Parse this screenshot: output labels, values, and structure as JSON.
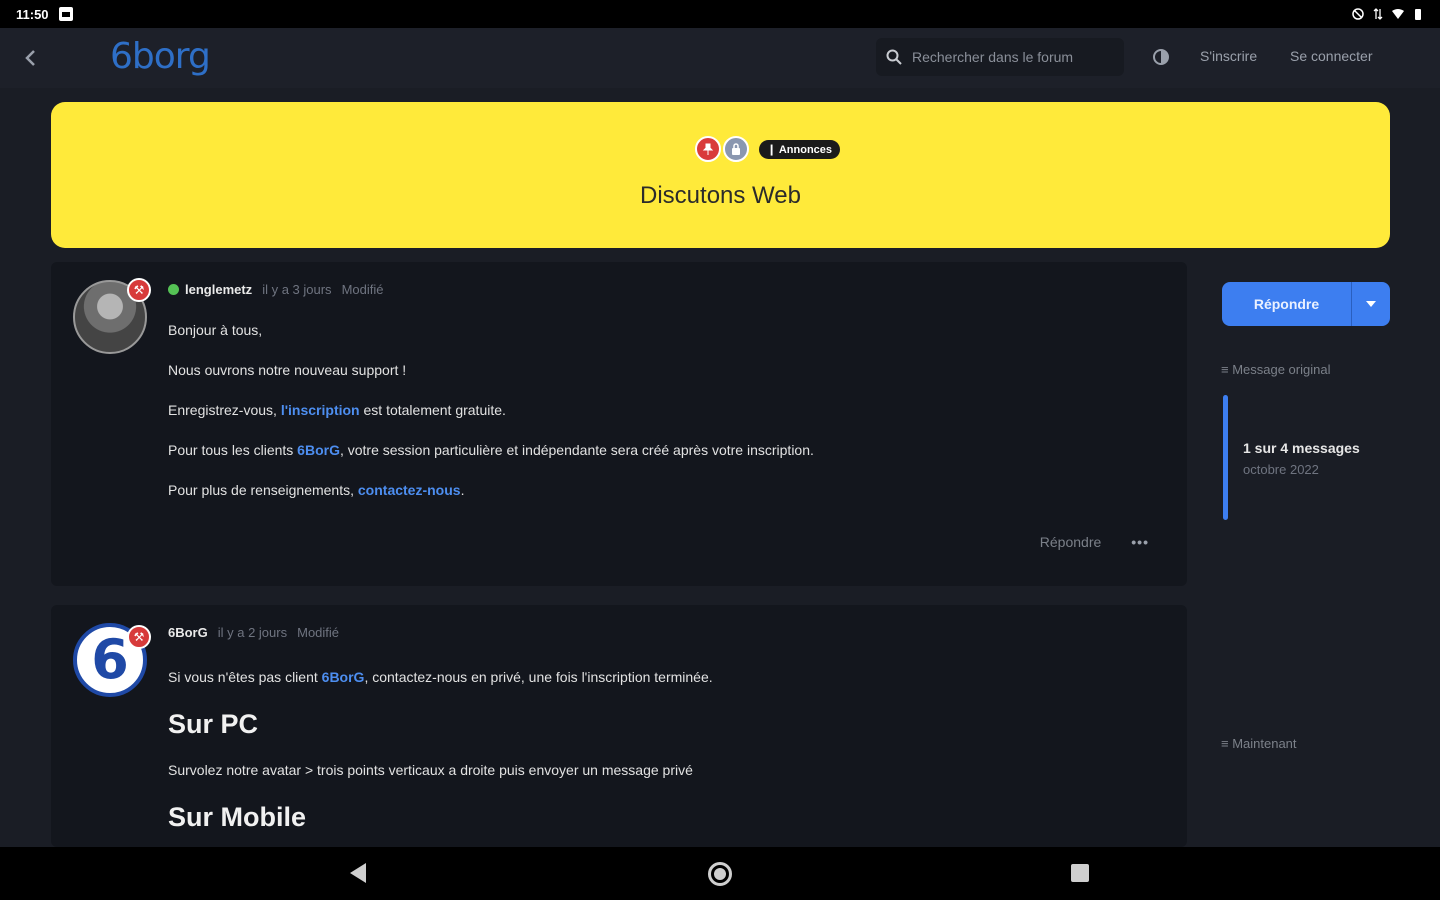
{
  "status_bar": {
    "time": "11:50"
  },
  "header": {
    "logo": "6borg",
    "search_placeholder": "Rechercher dans le forum",
    "register": "S'inscrire",
    "login": "Se connecter"
  },
  "banner": {
    "tag": "❙ Annonces",
    "title": "Discutons Web"
  },
  "posts": [
    {
      "author": "lenglemetz",
      "time": "il y a 3 jours",
      "modified": "Modifié",
      "lines": {
        "l1": "Bonjour à tous,",
        "l2": "Nous ouvrons notre nouveau support !",
        "l3a": "Enregistrez-vous, ",
        "l3link": "l'inscription",
        "l3b": " est totalement gratuite.",
        "l4a": "Pour tous les clients ",
        "l4link": "6BorG",
        "l4b": ", votre session particulière et indépendante sera créé après votre inscription.",
        "l5a": "Pour plus de renseignements, ",
        "l5link": "contactez-nous",
        "l5b": "."
      },
      "reply": "Répondre",
      "more": "•••"
    },
    {
      "author": "6BorG",
      "time": "il y a 2 jours",
      "modified": "Modifié",
      "lines": {
        "l1a": "Si vous n'êtes pas client ",
        "l1link": "6BorG",
        "l1b": ", contactez-nous en privé, une fois l'inscription terminée.",
        "h1": "Sur PC",
        "l2": "Survolez notre avatar > trois points verticaux a droite puis envoyer un message privé",
        "h2": "Sur Mobile"
      }
    }
  ],
  "sidebar": {
    "reply_button": "Répondre",
    "original_message": "≡ Message original",
    "count": "1 sur 4 messages",
    "date": "octobre 2022",
    "now": "≡ Maintenant"
  }
}
